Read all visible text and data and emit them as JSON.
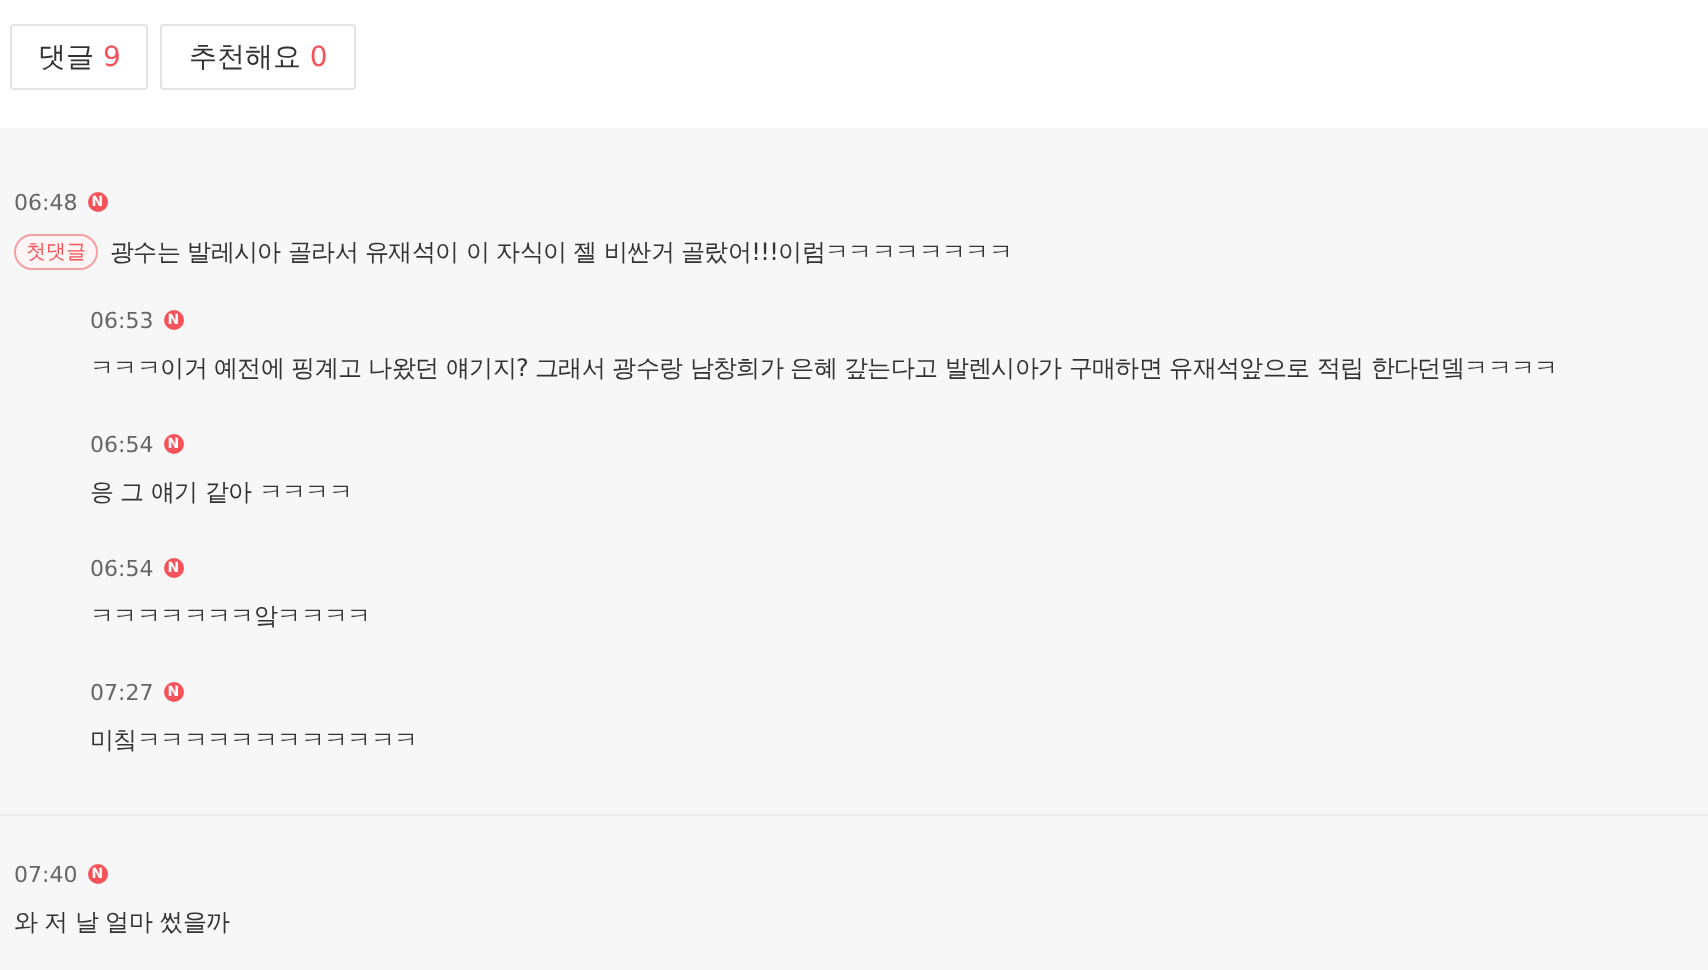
{
  "tabs": [
    {
      "label": "댓글",
      "count": "9"
    },
    {
      "label": "추천해요",
      "count": "0"
    }
  ],
  "comments": [
    {
      "time": "06:48",
      "new_mark": "N",
      "badge": "첫댓글",
      "text": "광수는 발레시아 골라서 유재석이 이 자식이 젤 비싼거 골랐어!!!이럼ㅋㅋㅋㅋㅋㅋㅋㅋ",
      "children": [
        {
          "time": "06:53",
          "new_mark": "N",
          "text": "ㅋㅋㅋ이거 예전에 핑계고 나왔던 얘기지? 그래서 광수랑 남창희가 은혜 갚는다고 발렌시아가 구매하면 유재석앞으로 적립 한다던뎈ㅋㅋㅋㅋ"
        },
        {
          "time": "06:54",
          "new_mark": "N",
          "text": "응 그 얘기 같아 ㅋㅋㅋㅋ"
        },
        {
          "time": "06:54",
          "new_mark": "N",
          "text": "ㅋㅋㅋㅋㅋㅋㅋ앜ㅋㅋㅋㅋ"
        },
        {
          "time": "07:27",
          "new_mark": "N",
          "text": "미칰ㅋㅋㅋㅋㅋㅋㅋㅋㅋㅋㅋㅋ"
        }
      ]
    },
    {
      "time": "07:40",
      "new_mark": "N",
      "text": "와 저 날 얼마 썼을까"
    }
  ]
}
